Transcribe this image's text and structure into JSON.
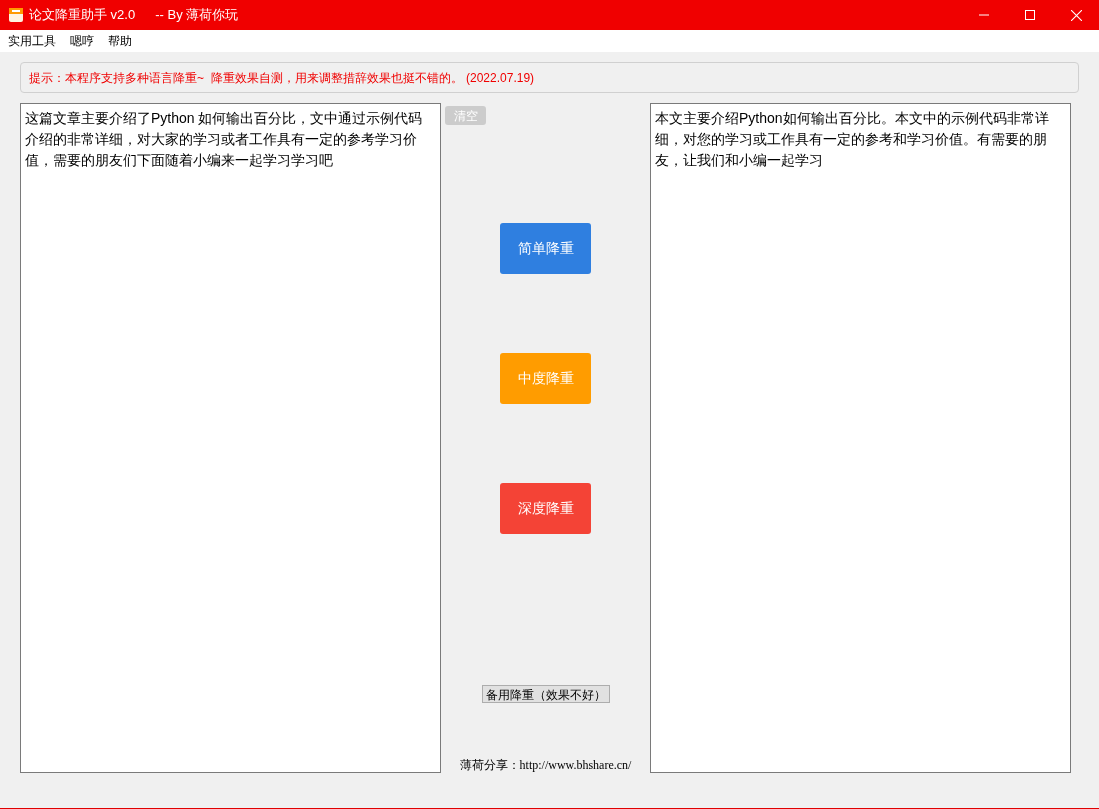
{
  "window": {
    "title": "论文降重助手 v2.0",
    "subtitle": "-- By 薄荷你玩"
  },
  "menu": [
    "实用工具",
    "嗯哼",
    "帮助"
  ],
  "notice": "提示：本程序支持多种语言降重~  降重效果自测，用来调整措辞效果也挺不错的。 (2022.07.19)",
  "input_text": "这篇文章主要介绍了Python 如何输出百分比，文中通过示例代码介绍的非常详细，对大家的学习或者工作具有一定的参考学习价值，需要的朋友们下面随着小编来一起学习学习吧",
  "clear_button": "清空",
  "actions": [
    {
      "label": "简单降重",
      "kind": "simple"
    },
    {
      "label": "中度降重",
      "kind": "medium"
    },
    {
      "label": "深度降重",
      "kind": "deep"
    }
  ],
  "backup_button": "备用降重（效果不好）",
  "footer": "薄荷分享：http://www.bhshare.cn/",
  "output_text": "本文主要介绍Python如何输出百分比。本文中的示例代码非常详细，对您的学习或工作具有一定的参考和学习价值。有需要的朋友，让我们和小编一起学习"
}
